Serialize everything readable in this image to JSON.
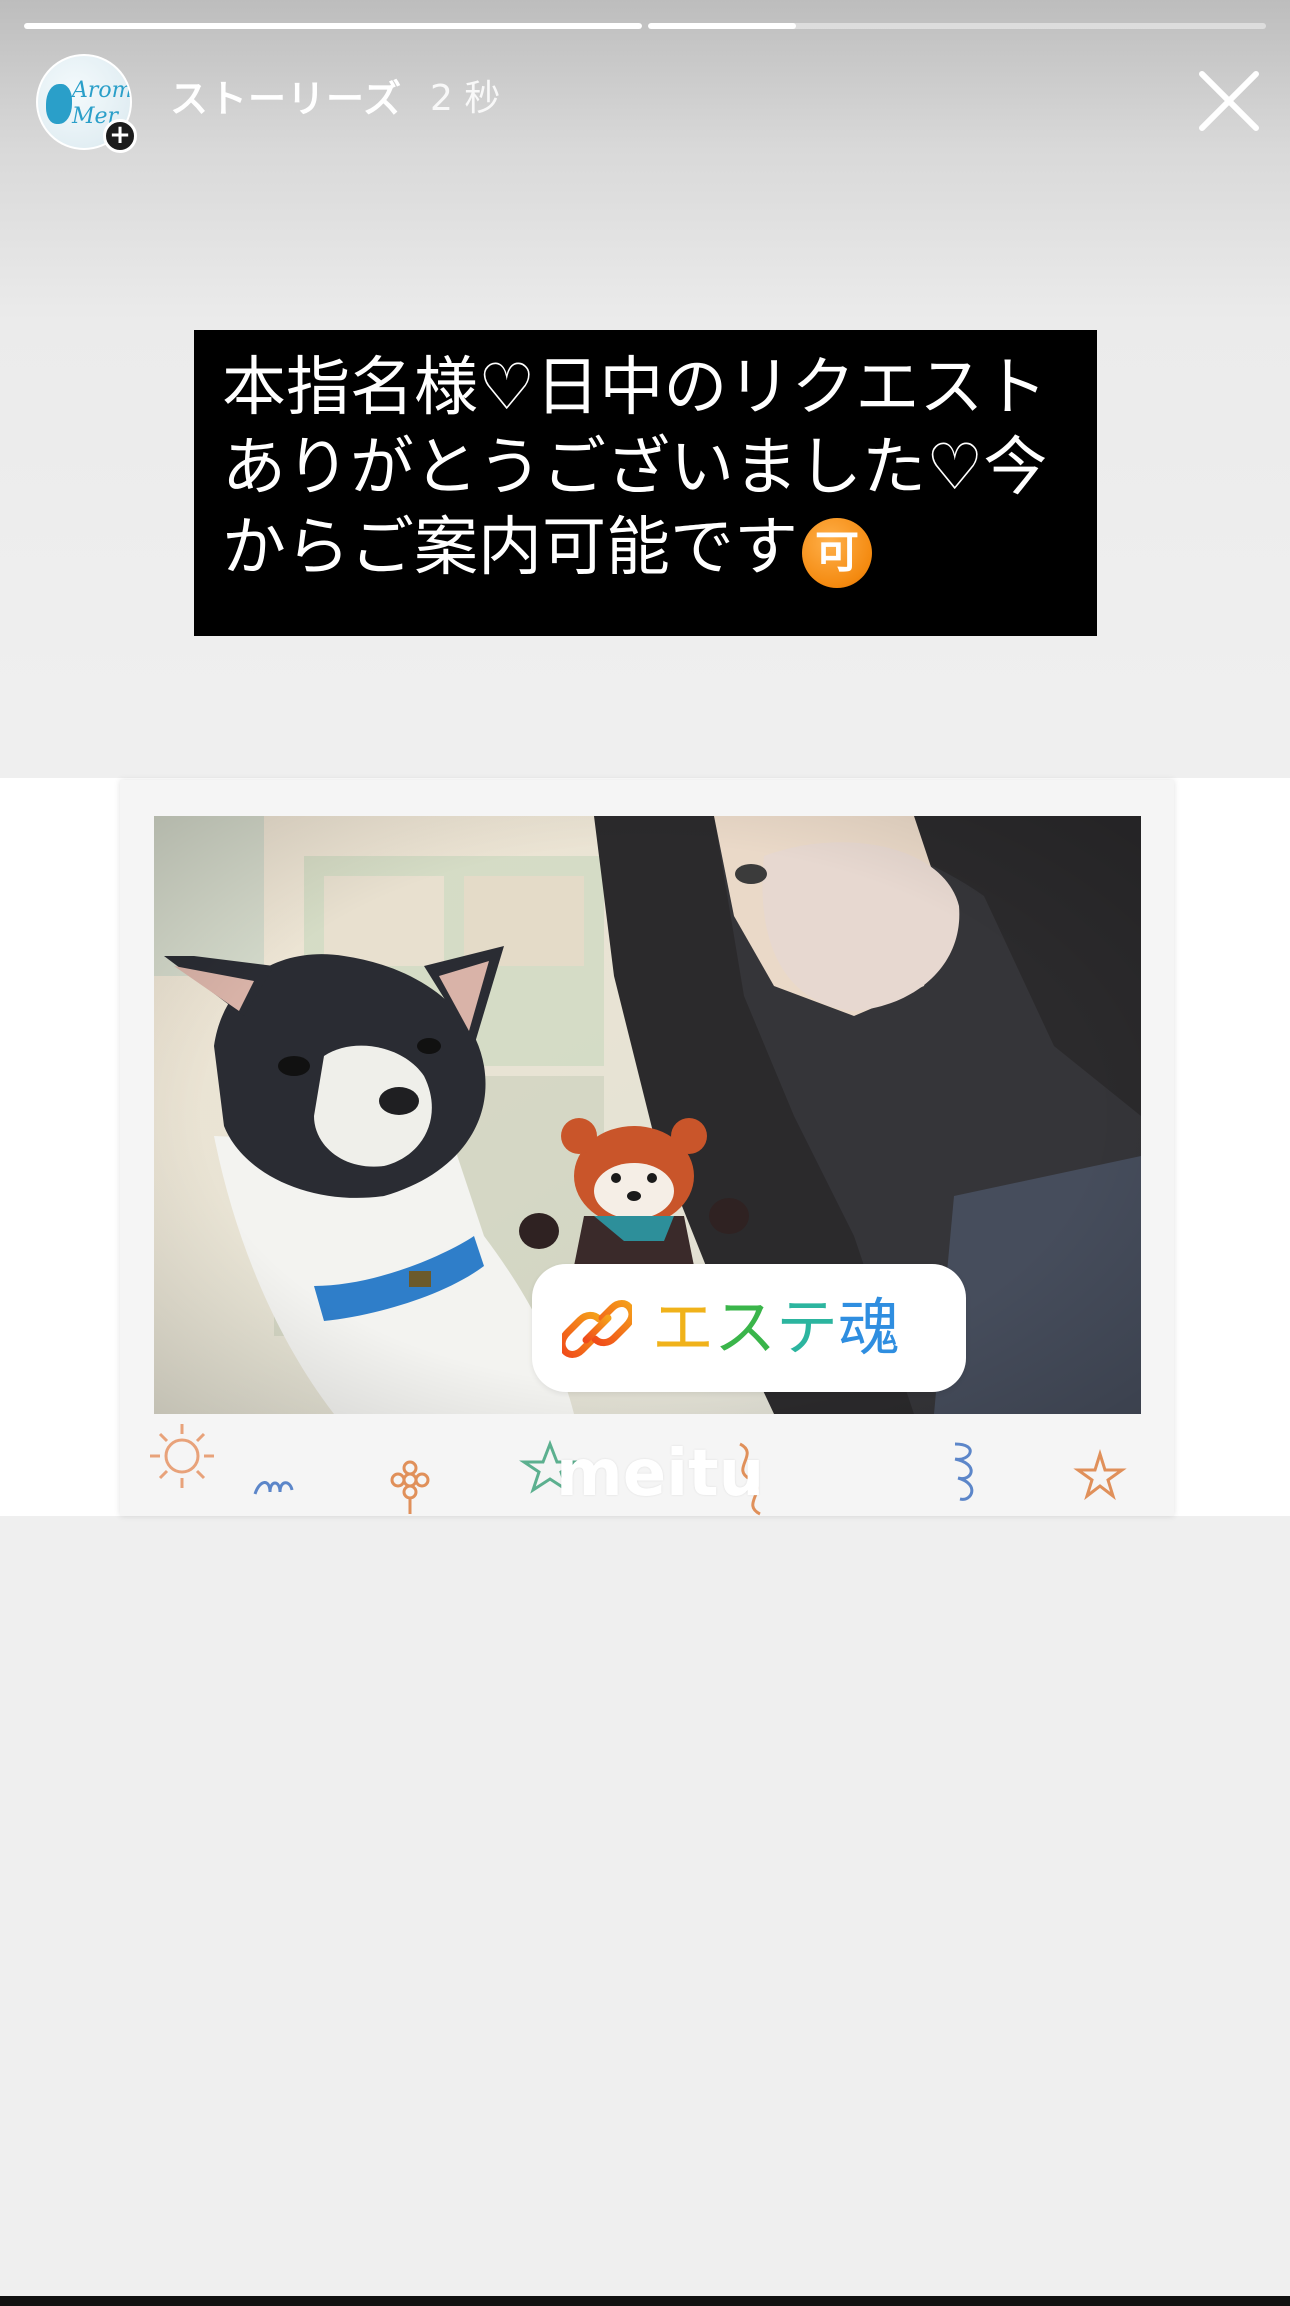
{
  "story": {
    "progress": [
      {
        "segment": 1,
        "filled_fraction": 1.0
      },
      {
        "segment": 2,
        "filled_fraction": 0.24
      }
    ],
    "header": {
      "avatar_logo_text": "Aroma Mer",
      "username": "ストーリーズ",
      "timestamp": "2 秒",
      "close_icon": "close-icon",
      "add_icon": "plus-icon"
    },
    "caption": {
      "text": "本指名様♡日中のリクエストありがとうございました♡今からご案内可能です",
      "emoji_label": "可",
      "emoji_color": "#f48a10"
    },
    "photo": {
      "link_sticker": {
        "label": "エステ魂",
        "icon": "link-icon"
      },
      "watermark": "meitu"
    },
    "colors": {
      "caption_bg": "#000000",
      "link_icon": "#f05a1a"
    }
  }
}
